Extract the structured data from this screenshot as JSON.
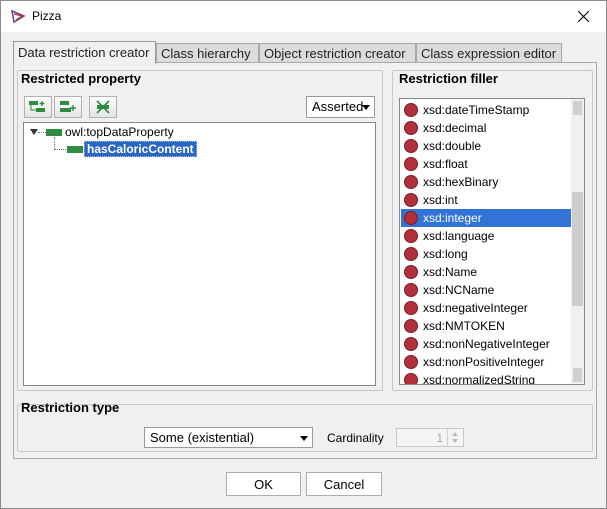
{
  "window": {
    "title": "Pizza"
  },
  "tabs": [
    {
      "label": "Data restriction creator",
      "active": true
    },
    {
      "label": "Class hierarchy",
      "active": false
    },
    {
      "label": "Object restriction creator",
      "active": false
    },
    {
      "label": "Class expression editor",
      "active": false
    }
  ],
  "restricted_property": {
    "title": "Restricted property",
    "view_mode": "Asserted",
    "toolbar_icons": [
      "add-subproperty-icon",
      "add-sibling-property-icon",
      "delete-property-icon"
    ],
    "tree": [
      {
        "label": "owl:topDataProperty",
        "expanded": true,
        "selected": false
      },
      {
        "label": "hasCaloricContent",
        "selected": true
      }
    ]
  },
  "restriction_filler": {
    "title": "Restriction filler",
    "items": [
      "xsd:dateTimeStamp",
      "xsd:decimal",
      "xsd:double",
      "xsd:float",
      "xsd:hexBinary",
      "xsd:int",
      "xsd:integer",
      "xsd:language",
      "xsd:long",
      "xsd:Name",
      "xsd:NCName",
      "xsd:negativeInteger",
      "xsd:NMTOKEN",
      "xsd:nonNegativeInteger",
      "xsd:nonPositiveInteger",
      "xsd:normalizedString"
    ],
    "selected": "xsd:integer"
  },
  "restriction_type": {
    "title": "Restriction type",
    "selected": "Some (existential)",
    "cardinality_label": "Cardinality",
    "cardinality_value": "1"
  },
  "buttons": {
    "ok": "OK",
    "cancel": "Cancel"
  },
  "colors": {
    "selection": "#3173d6",
    "datatype_dot": "#b0303b",
    "property_icon": "#2e8b3f"
  }
}
